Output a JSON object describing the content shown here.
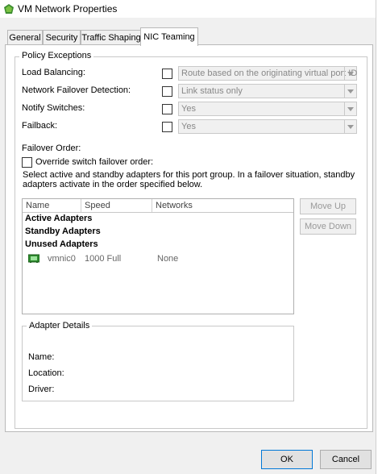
{
  "window": {
    "title": "VM Network Properties"
  },
  "tabs": [
    "General",
    "Security",
    "Traffic Shaping",
    "NIC Teaming"
  ],
  "policy": {
    "legend": "Policy Exceptions",
    "rows": [
      {
        "label": "Load Balancing:",
        "value": "Route based on the originating virtual port ID"
      },
      {
        "label": "Network Failover Detection:",
        "value": "Link status only"
      },
      {
        "label": "Notify Switches:",
        "value": "Yes"
      },
      {
        "label": "Failback:",
        "value": "Yes"
      }
    ],
    "failover_order_label": "Failover Order:",
    "override_label": "Override switch failover order:",
    "description_line1": "Select active and standby adapters for this port group.  In a failover situation, standby",
    "description_line2": "adapters activate  in the order specified below."
  },
  "adapters_table": {
    "columns": [
      "Name",
      "Speed",
      "Networks"
    ],
    "sections": [
      "Active Adapters",
      "Standby Adapters",
      "Unused Adapters"
    ],
    "nic": {
      "name": "vmnic0",
      "speed": "1000 Full",
      "networks": "None"
    }
  },
  "side_buttons": {
    "move_up": "Move Up",
    "move_down": "Move Down"
  },
  "adapter_details": {
    "legend": "Adapter Details",
    "name_label": "Name:",
    "location_label": "Location:",
    "driver_label": "Driver:"
  },
  "footer": {
    "ok": "OK",
    "cancel": "Cancel"
  },
  "colors": {
    "nic_icon": "#2e8b2e",
    "window_bg": "#f0f0f0"
  }
}
